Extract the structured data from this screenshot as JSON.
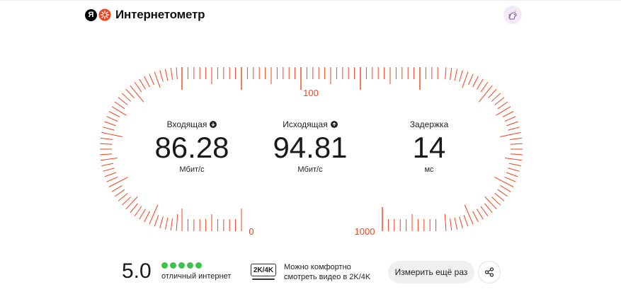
{
  "header": {
    "logo_letter": "Я",
    "app_title": "Интернетометр"
  },
  "gauge": {
    "labels": {
      "top": "100",
      "bottom_left": "0",
      "bottom_right": "1000"
    },
    "tick_color": "#f3421c"
  },
  "metrics": {
    "download": {
      "label": "Входящая",
      "value": "86.28",
      "unit": "Мбит/с",
      "icon": "download-icon"
    },
    "upload": {
      "label": "Исходящая",
      "value": "94.81",
      "unit": "Мбит/с",
      "icon": "upload-icon"
    },
    "latency": {
      "label": "Задержка",
      "value": "14",
      "unit": "мс"
    }
  },
  "footer": {
    "score": "5.0",
    "stars": 5,
    "star_color": "#3fc24b",
    "score_caption": "отличный интернет",
    "badge": "2K/4K",
    "video_text_line1": "Можно комфортно",
    "video_text_line2": "смотреть видео в 2K/4K",
    "retest_label": "Измерить ещё раз",
    "share_icon": "share-icon"
  }
}
